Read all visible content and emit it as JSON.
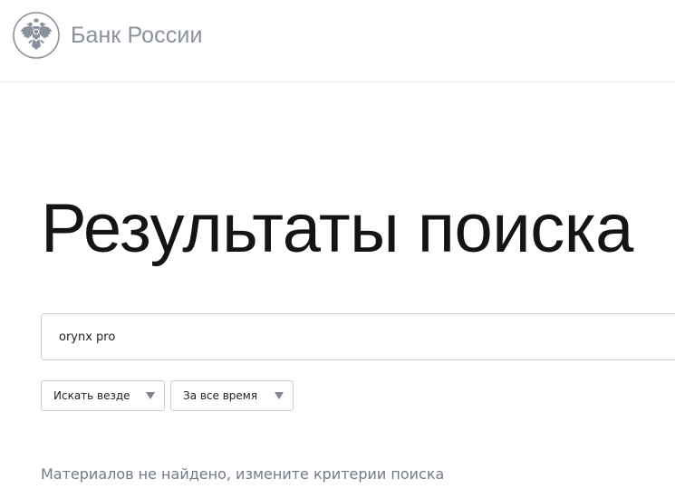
{
  "header": {
    "logo_text": "Банк России",
    "emblem_icon": "double-headed-eagle-icon"
  },
  "main": {
    "title": "Результаты поиска",
    "search": {
      "value": "orynx pro",
      "placeholder": ""
    },
    "filters": [
      {
        "label": "Искать везде",
        "icon": "caret-down-icon"
      },
      {
        "label": "За все время",
        "icon": "caret-down-icon"
      }
    ],
    "empty_message": "Материалов не найдено, измените критерии поиска"
  },
  "colors": {
    "logo_gray": "#8b919c",
    "border": "#c9ccd2",
    "muted_text": "#737a87",
    "title": "#141414"
  }
}
